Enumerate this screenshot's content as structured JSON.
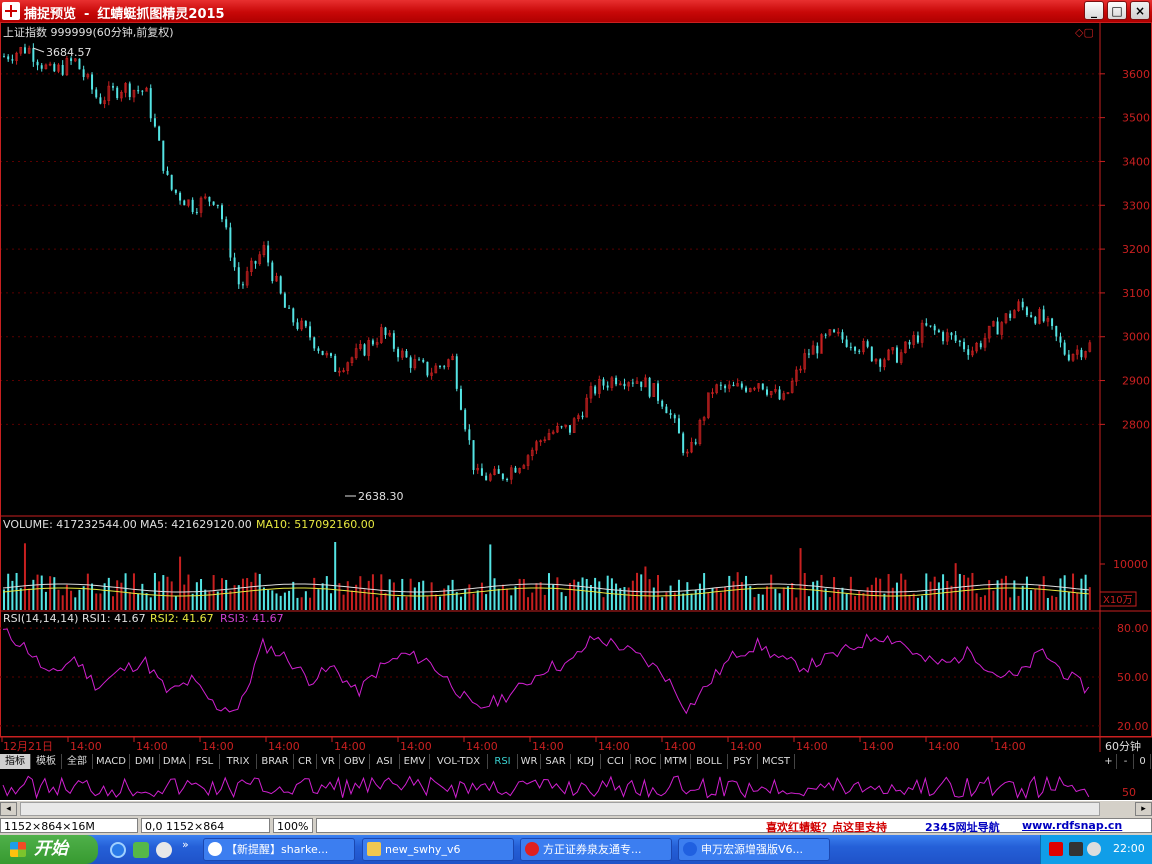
{
  "window": {
    "app_name": "捕捉预览",
    "separator": "-",
    "subtitle": "红蜻蜓抓图精灵2015",
    "min": "_",
    "max": "□",
    "close": "×"
  },
  "panel_main": {
    "title": "上证指数 999999(60分钟,前复权)",
    "high_label": "3684.57",
    "low_label": "2638.30",
    "y_ticks": [
      3600,
      3500,
      3400,
      3300,
      3200,
      3100,
      3000,
      2900,
      2800
    ]
  },
  "panel_vol": {
    "prefix": "VOLUME: 417232544.00",
    "ma5": "MA5: 421629120.00",
    "ma10": "MA10: 517092160.00",
    "y_tick": "10000",
    "unit": "X10万"
  },
  "panel_rsi": {
    "prefix": "RSI(14,14,14)",
    "rsi1": "RSI1: 41.67",
    "rsi2": "RSI2: 41.67",
    "rsi3": "RSI3: 41.67",
    "y_ticks": [
      "80.00",
      "50.00",
      "20.00"
    ]
  },
  "axis": {
    "first": "12月21日",
    "label": "14:00",
    "period": "60分钟",
    "count": 16
  },
  "tabs": [
    "指标",
    "模板",
    "全部",
    "MACD",
    "DMI",
    "DMA",
    "FSL",
    "TRIX",
    "BRAR",
    "CR",
    "VR",
    "OBV",
    "ASI",
    "EMV",
    "VOL-TDX",
    "RSI",
    "WR",
    "SAR",
    "KDJ",
    "CCI",
    "ROC",
    "MTM",
    "BOLL",
    "PSY",
    "MCST"
  ],
  "active_tab": "RSI",
  "tab_controls": [
    "+",
    "-",
    "0"
  ],
  "extra_tick": "50",
  "status": {
    "size": "1152×864×16M",
    "pos": "0,0 1152×864",
    "zoom": "100%",
    "promo": "喜欢红蜻蜓？点这里支持",
    "nav": "2345网址导航",
    "site": "www.rdfsnap.cn"
  },
  "taskbar": {
    "start": "开始",
    "tasks": [
      "【新提醒】sharke...",
      "new_swhy_v6",
      "方正证券泉友通专...",
      "申万宏源增强版V6..."
    ],
    "clock": "22:00"
  },
  "chart_data": {
    "type": "candlestick",
    "title": "上证指数 999999(60分钟,前复权)",
    "close_path": [
      3640,
      3660,
      3600,
      3630,
      3540,
      3570,
      3560,
      3340,
      3300,
      3320,
      3110,
      3200,
      3050,
      3000,
      2930,
      2960,
      3010,
      2950,
      2920,
      2950,
      2680,
      2680,
      2720,
      2780,
      2790,
      2880,
      2910,
      2900,
      2850,
      2720,
      2880,
      2880,
      2900,
      2850,
      2960,
      3000,
      2990,
      2950,
      2960,
      3020,
      3000,
      2970,
      3020,
      3070,
      3040,
      2960,
      2980
    ],
    "high": 3684.57,
    "low": 2638.3,
    "ylim": [
      2600,
      3700
    ],
    "rsi_path": [
      78,
      68,
      50,
      62,
      44,
      54,
      60,
      40,
      48,
      32,
      30,
      70,
      62,
      48,
      56,
      40,
      56,
      64,
      60,
      46,
      30,
      36,
      44,
      56,
      58,
      74,
      70,
      62,
      52,
      30,
      48,
      64,
      70,
      60,
      56,
      62,
      68,
      76,
      72,
      60,
      58,
      66,
      52,
      50,
      66,
      52,
      42
    ]
  }
}
